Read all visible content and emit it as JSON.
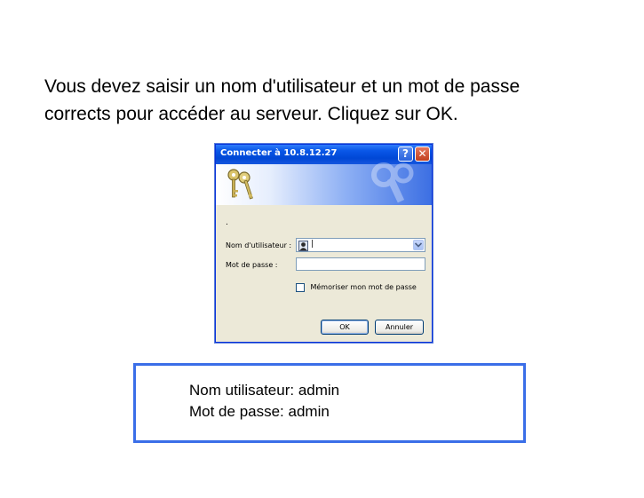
{
  "instruction": {
    "line1": "Vous devez saisir un nom d'utilisateur et un mot de passe",
    "line2": "corrects pour accéder au serveur.  Cliquez sur OK."
  },
  "dialog": {
    "title": "Connecter à 10.8.12.27",
    "help_button": "?",
    "close_button": "✕",
    "dot_text": ".",
    "user_label": "Nom d'utilisateur :",
    "user_value": "|",
    "password_label": "Mot de passe :",
    "password_value": "",
    "remember_label": "Mémoriser mon mot de passe",
    "remember_checked": false,
    "ok_button": "OK",
    "cancel_button": "Annuler",
    "icons": {
      "banner": "keys-icon",
      "user": "user-icon",
      "dropdown": "chevron-down-icon"
    }
  },
  "credentials": {
    "user_line": "Nom utilisateur: admin",
    "password_line": "Mot de passe: admin"
  },
  "colors": {
    "titlebar": "#0a58e8",
    "dialog_bg": "#ece9d8",
    "cred_border": "#3a6ee8"
  }
}
